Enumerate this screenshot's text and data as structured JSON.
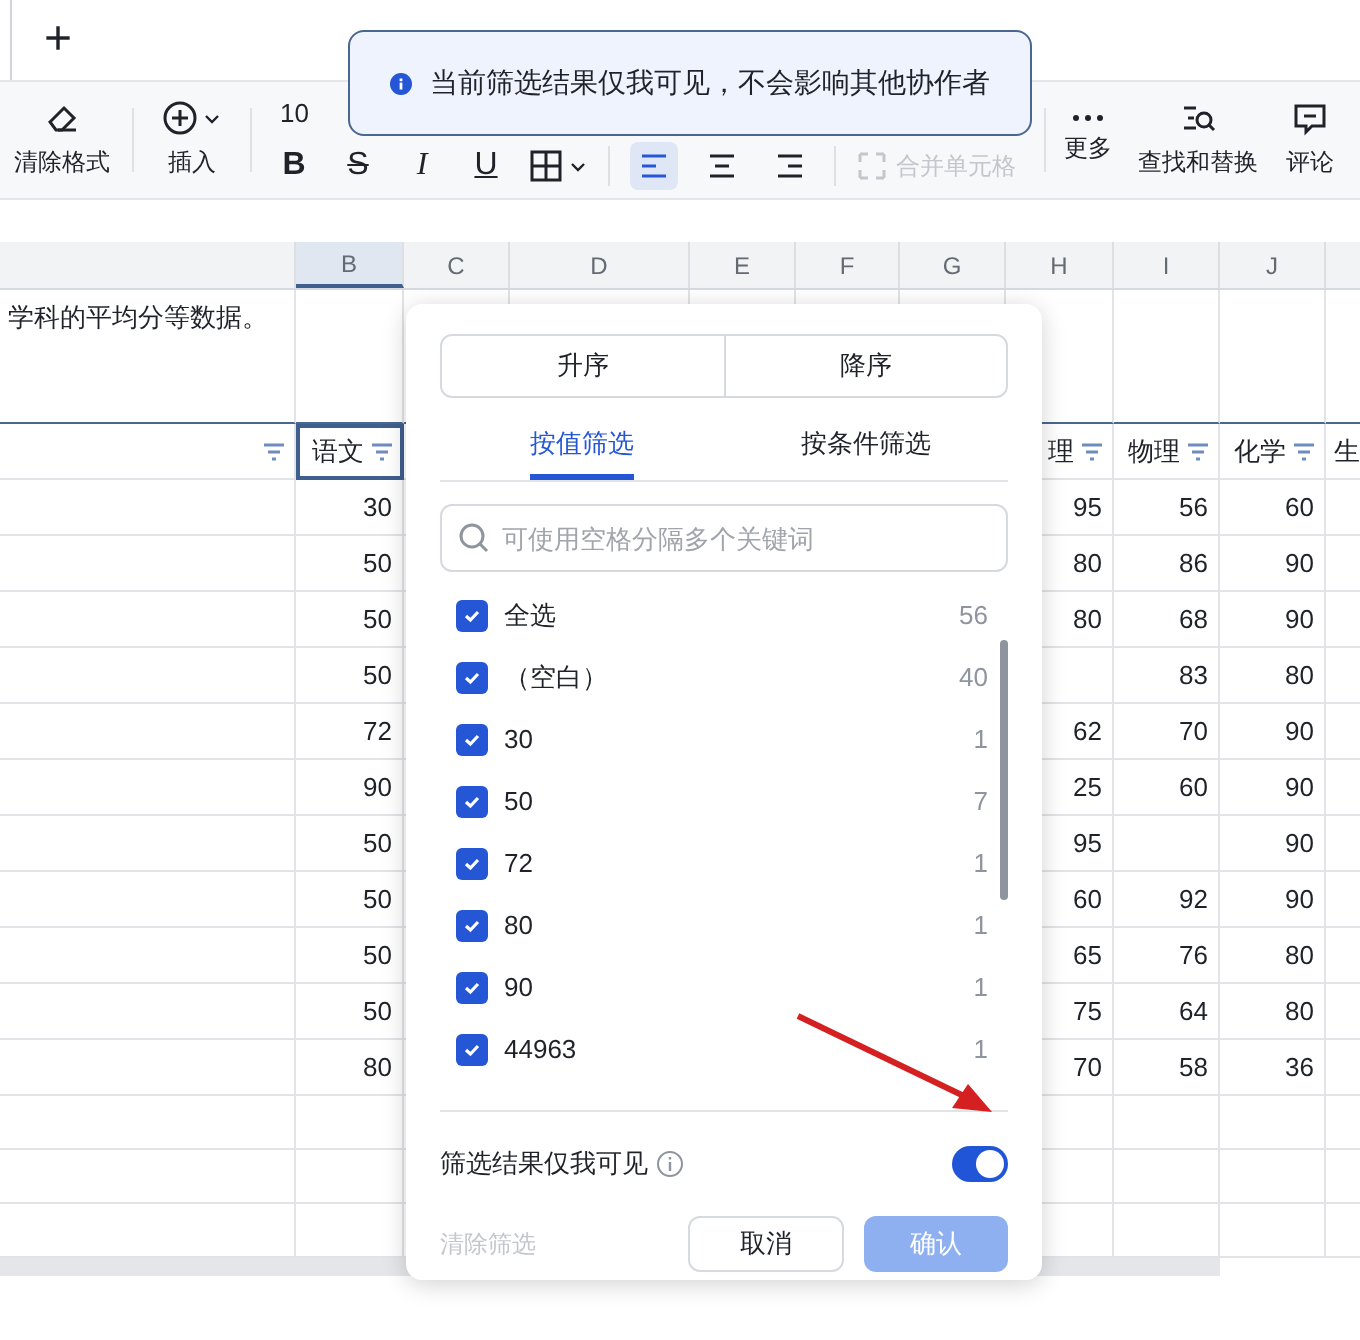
{
  "tab_bar": {
    "add_label": "+"
  },
  "toolbar": {
    "clear_format": "清除格式",
    "insert": "插入",
    "font_size": "10",
    "bold": "B",
    "strike": "S",
    "italic": "I",
    "underline": "U",
    "align": [
      {
        "kind": "left",
        "selected": true
      },
      {
        "kind": "center",
        "selected": false
      },
      {
        "kind": "right",
        "selected": false
      }
    ],
    "merge_cells": {
      "label": "合并单元格",
      "disabled": true
    },
    "more": "更多",
    "find_replace": "查找和替换",
    "comment": "评论"
  },
  "toast": {
    "text": "当前筛选结果仅我可见，不会影响其他协作者"
  },
  "sheet": {
    "columns": [
      {
        "letter": "B",
        "selected": true
      },
      {
        "letter": "C",
        "selected": false
      },
      {
        "letter": "D",
        "selected": false
      },
      {
        "letter": "E",
        "selected": false
      },
      {
        "letter": "F",
        "selected": false
      },
      {
        "letter": "G",
        "selected": false
      },
      {
        "letter": "H",
        "selected": false
      },
      {
        "letter": "I",
        "selected": false
      },
      {
        "letter": "J",
        "selected": false
      }
    ],
    "title_text": "学科的平均分等数据。",
    "header": [
      {
        "filter": true
      },
      {
        "text": "语文",
        "filter": true,
        "selected": true
      },
      {
        "text": "理",
        "filter": true
      },
      {
        "text": "物理",
        "filter": true
      },
      {
        "text": "化学",
        "filter": true
      },
      {
        "text": "生"
      }
    ],
    "rows": [
      [
        "30",
        "95",
        "56",
        "60"
      ],
      [
        "50",
        "80",
        "86",
        "90"
      ],
      [
        "50",
        "80",
        "68",
        "90"
      ],
      [
        "50",
        "",
        "83",
        "80"
      ],
      [
        "72",
        "62",
        "70",
        "90"
      ],
      [
        "90",
        "25",
        "60",
        "90"
      ],
      [
        "50",
        "95",
        "",
        "90"
      ],
      [
        "50",
        "60",
        "92",
        "90"
      ],
      [
        "50",
        "65",
        "76",
        "80"
      ],
      [
        "50",
        "75",
        "64",
        "80"
      ],
      [
        "80",
        "70",
        "58",
        "36"
      ]
    ]
  },
  "filter_panel": {
    "sort_buttons": [
      "升序",
      "降序"
    ],
    "tabs": [
      {
        "label": "按值筛选",
        "selected": true
      },
      {
        "label": "按条件筛选",
        "selected": false
      }
    ],
    "search": {
      "placeholder": "可使用空格分隔多个关键词"
    },
    "items": [
      {
        "label": "全选",
        "count": "56",
        "checked": true
      },
      {
        "label": "（空白）",
        "count": "40",
        "checked": true
      },
      {
        "label": "30",
        "count": "1",
        "checked": true
      },
      {
        "label": "50",
        "count": "7",
        "checked": true
      },
      {
        "label": "72",
        "count": "1",
        "checked": true
      },
      {
        "label": "80",
        "count": "1",
        "checked": true
      },
      {
        "label": "90",
        "count": "1",
        "checked": true
      },
      {
        "label": "44963",
        "count": "1",
        "checked": true
      }
    ],
    "visibility_toggle": {
      "label": "筛选结果仅我可见",
      "on": true
    },
    "clear_filter": {
      "label": "清除筛选",
      "disabled": true
    },
    "cancel": "取消",
    "confirm": {
      "label": "确认",
      "disabled": true
    }
  }
}
